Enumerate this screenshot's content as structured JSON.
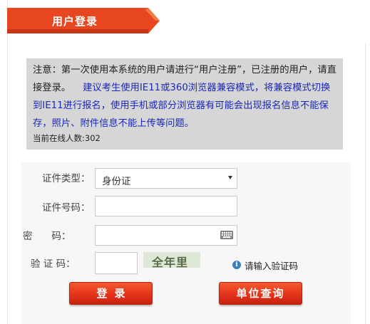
{
  "header": {
    "title": "用户登录",
    "accent_color": "#e8461f"
  },
  "notice": {
    "text_black": "注意：第一次使用本系统的用户请进行“用户注册”，已注册的用户，请直接登录。",
    "text_blue": "建议考生使用IE11或360浏览器兼容模式，将兼容模式切换到IE11进行报名，使用手机或部分浏览器有可能会出现报名信息不能保存，照片、附件信息不能上传等问题。",
    "online_count": "当前在线人数:302"
  },
  "form": {
    "id_type_label": "证件类型：",
    "id_type_value": "身份证",
    "id_number_label": "证件号码：",
    "id_number_value": "",
    "password_label": "密　　码：",
    "password_value": "",
    "captcha_label": "验 证 码：",
    "captcha_value": "",
    "captcha_image_text": "全年里",
    "captcha_hint": "请输入验证码"
  },
  "buttons": {
    "login": "登录",
    "query": "单位查询"
  },
  "icons": {
    "dropdown": "chevron-down-icon",
    "keyboard": "keyboard-icon",
    "info": "info-icon"
  }
}
